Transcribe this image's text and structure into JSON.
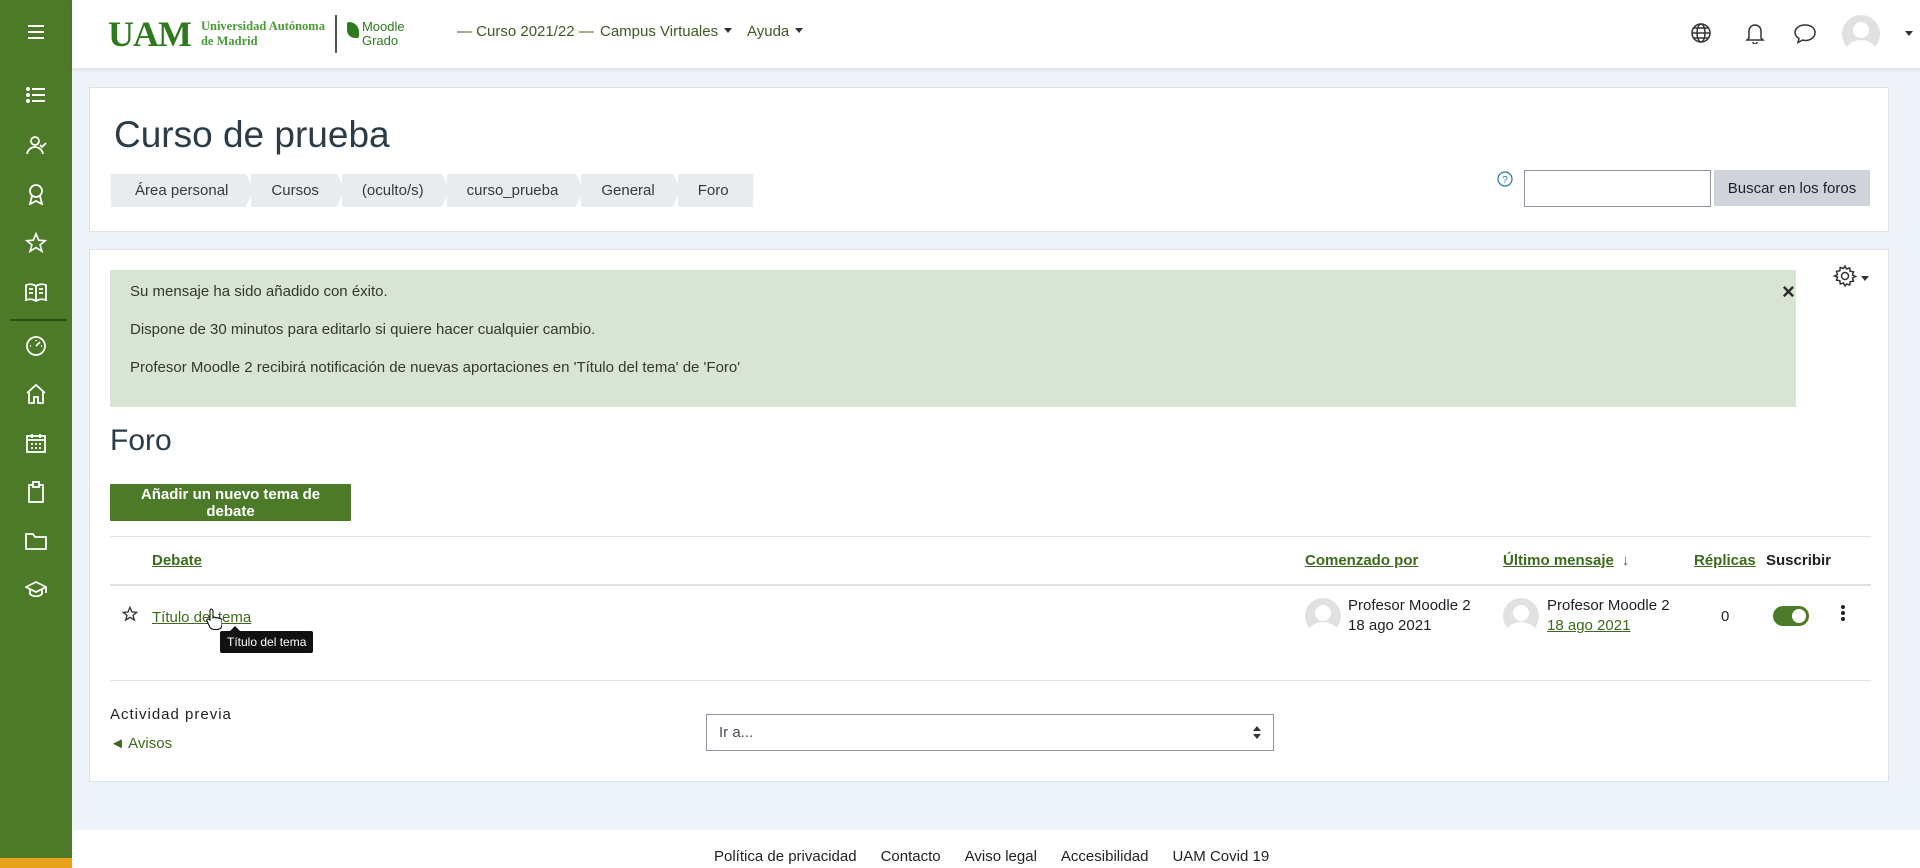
{
  "colors": {
    "brand_green": "#4d7a29",
    "link_green": "#3d6a1c",
    "alert_bg": "#d9e5d4",
    "accent_orange": "#e8a21a"
  },
  "rail": {
    "items": [
      "menu-icon",
      "list-icon",
      "users-icon",
      "badge-icon",
      "star-icon",
      "book-icon",
      "dashboard-icon",
      "home-icon",
      "calendar-icon",
      "clipboard-icon",
      "folder-icon",
      "graduation-cap-icon"
    ]
  },
  "logo": {
    "mark": "UAM",
    "name_line1": "Universidad Autónoma",
    "name_line2": "de Madrid",
    "moodle_line1": "Moodle",
    "moodle_line2": "Grado"
  },
  "topnav": {
    "course_year": "— Curso 2021/22 —",
    "campus": "Campus Virtuales",
    "help": "Ayuda"
  },
  "header": {
    "title": "Curso de prueba",
    "breadcrumb": [
      "Área personal",
      "Cursos",
      "(oculto/s)",
      "curso_prueba",
      "General",
      "Foro"
    ],
    "search_placeholder": "",
    "search_button": "Buscar en los foros"
  },
  "alert": {
    "line1": "Su mensaje ha sido añadido con éxito.",
    "line2": "Dispone de 30 minutos para editarlo si quiere hacer cualquier cambio.",
    "line3": "Profesor Moodle 2 recibirá notificación de nuevas aportaciones en 'Título del tema' de 'Foro'",
    "close": "×"
  },
  "forum": {
    "title": "Foro",
    "add_button": "Añadir un nuevo tema de debate",
    "columns": {
      "debate": "Debate",
      "started_by": "Comenzado por",
      "last_post": "Último mensaje",
      "replies": "Réplicas",
      "subscribe": "Suscribir"
    },
    "rows": [
      {
        "topic": "Título del tema",
        "tooltip": "Título del tema",
        "starter_name": "Profesor Moodle 2",
        "starter_date": "18 ago 2021",
        "last_name": "Profesor Moodle 2",
        "last_date": "18 ago 2021",
        "replies": "0",
        "subscribed": true
      }
    ]
  },
  "navigation": {
    "prev_label": "Actividad previa",
    "prev_link": "◄ Avisos",
    "jump_select": "Ir a..."
  },
  "footer": {
    "links": [
      "Política de privacidad",
      "Contacto",
      "Aviso legal",
      "Accesibilidad",
      "UAM Covid 19"
    ]
  }
}
